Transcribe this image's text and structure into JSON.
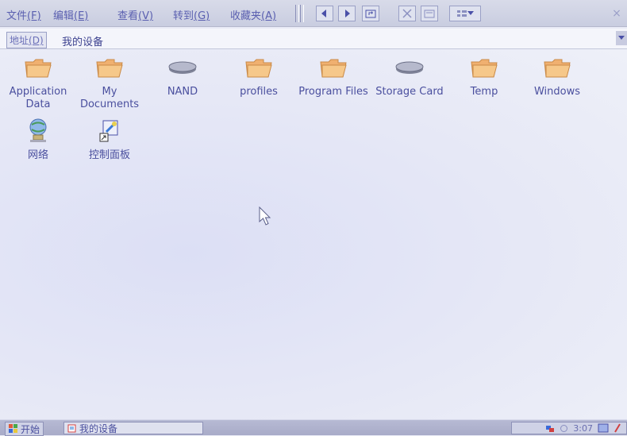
{
  "menu": [
    {
      "text": "文件",
      "accel": "(F)"
    },
    {
      "text": "编辑",
      "accel": "(E)"
    },
    {
      "text": "查看",
      "accel": "(V)"
    },
    {
      "text": "转到",
      "accel": "(G)"
    },
    {
      "text": "收藏夹",
      "accel": "(A)"
    }
  ],
  "toolbar": {
    "close_label": "×"
  },
  "address": {
    "label_text": "地址",
    "label_accel": "(D)",
    "value": "我的设备"
  },
  "items": [
    {
      "label": "Application Data",
      "icon": "folder-icon"
    },
    {
      "label": "My Documents",
      "icon": "folder-icon"
    },
    {
      "label": "NAND",
      "icon": "drive-icon"
    },
    {
      "label": "profiles",
      "icon": "folder-icon"
    },
    {
      "label": "Program Files",
      "icon": "folder-icon"
    },
    {
      "label": "Storage Card",
      "icon": "drive-icon"
    },
    {
      "label": "Temp",
      "icon": "folder-icon"
    },
    {
      "label": "Windows",
      "icon": "folder-icon"
    },
    {
      "label": "网络",
      "icon": "network-icon"
    },
    {
      "label": "控制面板",
      "icon": "control-panel-icon"
    }
  ],
  "taskbar": {
    "start_label": "开始",
    "task_label": "我的设备",
    "clock": "3:07"
  },
  "colors": {
    "folder": "#f0b070",
    "accent": "#4a4f9e",
    "background": "#e9ebf6"
  }
}
